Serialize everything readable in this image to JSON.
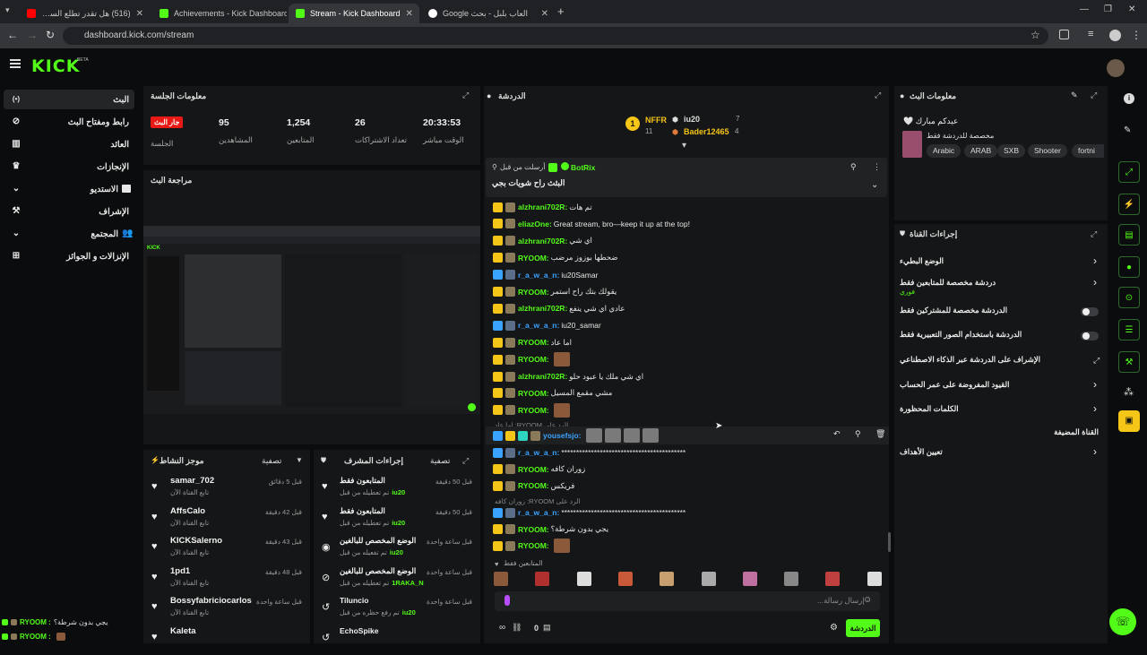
{
  "browser": {
    "tabs": [
      {
        "title": "(516) هل تقدر تطلع السعودي الد..."
      },
      {
        "title": "Achievements - Kick Dashboard"
      },
      {
        "title": "Stream - Kick Dashboard"
      },
      {
        "title": "العاب بلبل - بحث Google"
      }
    ],
    "url": "dashboard.kick.com/stream"
  },
  "app": {
    "logo": "KICK",
    "beta": "BETA"
  },
  "sidebar": {
    "items": [
      {
        "label": "البث",
        "icon": "live-icon"
      },
      {
        "label": "رابط ومفتاح البث",
        "icon": "link-icon"
      },
      {
        "label": "العائد",
        "icon": "chart-icon"
      },
      {
        "label": "الإنجازات",
        "icon": "trophy-icon"
      },
      {
        "label": "الاستديو",
        "icon": "studio-icon"
      },
      {
        "label": "الإشراف",
        "icon": "wrench-icon"
      },
      {
        "label": "المجتمع",
        "icon": "community-icon"
      },
      {
        "label": "الإنزالات و الجوائز",
        "icon": "gift-icon"
      }
    ]
  },
  "session": {
    "title": "معلومات الجلسة",
    "live": "جار البث",
    "session_label": "الجلسة",
    "stats": [
      {
        "value": "95",
        "label": "المشاهدين"
      },
      {
        "value": "1,254",
        "label": "المتابعين"
      },
      {
        "value": "26",
        "label": "تعداد الاشتراكات"
      },
      {
        "value": "20:33:53",
        "label": "الوقت مباشر"
      }
    ]
  },
  "preview": {
    "title": "مراجعة البث"
  },
  "activity": {
    "title": "موجز النشاط",
    "filter": "تصفية",
    "items": [
      {
        "name": "samar_702",
        "sub": "تابع القناة الآن",
        "time": "قبل 5 دقائق"
      },
      {
        "name": "AffsCalo",
        "sub": "تابع القناة الآن",
        "time": "قبل 42 دقيقة"
      },
      {
        "name": "KICKSalerno",
        "sub": "تابع القناة الآن",
        "time": "قبل 43 دقيقة"
      },
      {
        "name": "1pd1",
        "sub": "تابع القناة الآن",
        "time": "قبل 48 دقيقة"
      },
      {
        "name": "Bossyfabriciocarlos",
        "sub": "تابع القناة الآن",
        "time": "قبل ساعة واحدة"
      },
      {
        "name": "Kaleta",
        "sub": "",
        "time": ""
      }
    ]
  },
  "modactions": {
    "title": "إجراءات المشرف",
    "filter": "تصفية",
    "items": [
      {
        "name": "المتابعون فقط",
        "sub": "تم تعطيله من قبل",
        "by": "iu20",
        "time": "قبل 50 دقيقة"
      },
      {
        "name": "المتابعون فقط",
        "sub": "تم تعطيله من قبل",
        "by": "iu20",
        "time": "قبل 50 دقيقة"
      },
      {
        "name": "الوضع المخصص للبالغين",
        "sub": "تم تفعيله من قبل",
        "by": "iu20",
        "time": "قبل ساعة واحدة"
      },
      {
        "name": "الوضع المخصص للبالغين",
        "sub": "تم تعطيله من قبل",
        "by": "1RAKA_N",
        "time": "قبل ساعة واحدة"
      },
      {
        "name": "Tiluncio",
        "sub": "تم رفع حظره من قبل",
        "by": "iu20",
        "time": "قبل ساعة واحدة"
      },
      {
        "name": "EchoSpike",
        "sub": "",
        "by": "",
        "time": ""
      }
    ]
  },
  "chat": {
    "title": "الدردشة",
    "leaderboard": {
      "rank": "1",
      "first": {
        "name": "NFFR",
        "count": "11"
      },
      "second": {
        "name": "iu20",
        "count": "7"
      },
      "third": {
        "name": "Bader12465",
        "count": "4"
      }
    },
    "pinned": {
      "by": "أرسلت من قبل",
      "bot": "BotRix",
      "text": "البثث راح شويات بجي"
    },
    "messages": [
      {
        "user": "alzhrani702R:",
        "text": "تم هات",
        "color": "#53fc18"
      },
      {
        "user": "eliazOne:",
        "text": "Great stream, bro—keep it up at the top!",
        "color": "#53fc18"
      },
      {
        "user": "alzhrani702R:",
        "text": "اي شي",
        "color": "#53fc18"
      },
      {
        "user": "RYOOM:",
        "text": "ضحطها بوزوز مرضب",
        "color": "#53fc18"
      },
      {
        "user": "r_a_w_a_n:",
        "text": "iu20Samar",
        "color": "#3aa3ff"
      },
      {
        "user": "RYOOM:",
        "text": "يقولك بتك راح استمر",
        "color": "#53fc18"
      },
      {
        "user": "alzhrani702R:",
        "text": "عادي اي شي ينفع",
        "color": "#53fc18"
      },
      {
        "user": "r_a_w_a_n:",
        "text": "iu20_samar",
        "color": "#3aa3ff"
      },
      {
        "user": "RYOOM:",
        "text": "اما عاد",
        "color": "#53fc18"
      },
      {
        "user": "RYOOM:",
        "text": "",
        "color": "#53fc18"
      },
      {
        "user": "alzhrani702R:",
        "text": "اي شي ملك يا عبود حلو",
        "color": "#53fc18"
      },
      {
        "user": "RYOOM:",
        "text": "مشي مقمع المسيل",
        "color": "#53fc18"
      },
      {
        "user": "RYOOM:",
        "text": "",
        "color": "#53fc18"
      }
    ],
    "reply1": "الرد على RYOOM: اما عاد",
    "highlighted": {
      "user": "yousefsjo:",
      "color": "#3aa3ff"
    },
    "msg2": [
      {
        "user": "r_a_w_a_n:",
        "text": "******************************************",
        "color": "#3aa3ff"
      },
      {
        "user": "RYOOM:",
        "text": "زوران كافه",
        "color": "#53fc18"
      },
      {
        "user": "RYOOM:",
        "text": "فريكس",
        "color": "#53fc18"
      }
    ],
    "reply2": "الرد على RYOOM: زوران كافه",
    "msg3": [
      {
        "user": "r_a_w_a_n:",
        "text": "******************************************",
        "color": "#3aa3ff"
      },
      {
        "user": "RYOOM:",
        "text": "يجي بدون شرطة؟",
        "color": "#53fc18"
      },
      {
        "user": "RYOOM:",
        "text": "",
        "color": "#53fc18"
      }
    ],
    "followers_only": "المتابعين فقط",
    "input_placeholder": "إرسال رسالة...",
    "send": "الدردشة",
    "points": "0"
  },
  "stream_info": {
    "title": "معلومات البث",
    "stream_title": "عيدكم مبارك",
    "subtitle": "مخصصة للدردشة فقط",
    "tags": [
      "Arabic",
      "ARAB",
      "SXB",
      "Shooter",
      "fortni"
    ]
  },
  "channel_actions": {
    "title": "إجراءات القناة",
    "items": [
      {
        "label": "الوضع البطيء",
        "type": "chevron"
      },
      {
        "label": "دردشة مخصصة للمتابعين فقط",
        "sub": "فوري",
        "type": "chevron"
      },
      {
        "label": "الدردشة مخصصة للمشتركين فقط",
        "type": "toggle"
      },
      {
        "label": "الدردشة باستخدام الصور التعبيرية فقط",
        "type": "toggle"
      },
      {
        "label": "الإشراف على الدردشة عبر الذكاء الاصطناعي",
        "type": "link"
      },
      {
        "label": "القيود المفروضة على عمر الحساب",
        "type": "chevron"
      },
      {
        "label": "الكلمات المحظورة",
        "type": "chevron"
      },
      {
        "label": "القناة المضيفة",
        "type": "none"
      },
      {
        "label": "تعيين الأهداف",
        "type": "chevron"
      }
    ]
  },
  "ticker": [
    {
      "user": "RYOOM :",
      "text": "يجي بدون شرطة؟"
    },
    {
      "user": "RYOOM :",
      "text": ""
    }
  ],
  "colors": {
    "accent": "#53fc18",
    "live": "#e91916",
    "panel": "#151617"
  }
}
